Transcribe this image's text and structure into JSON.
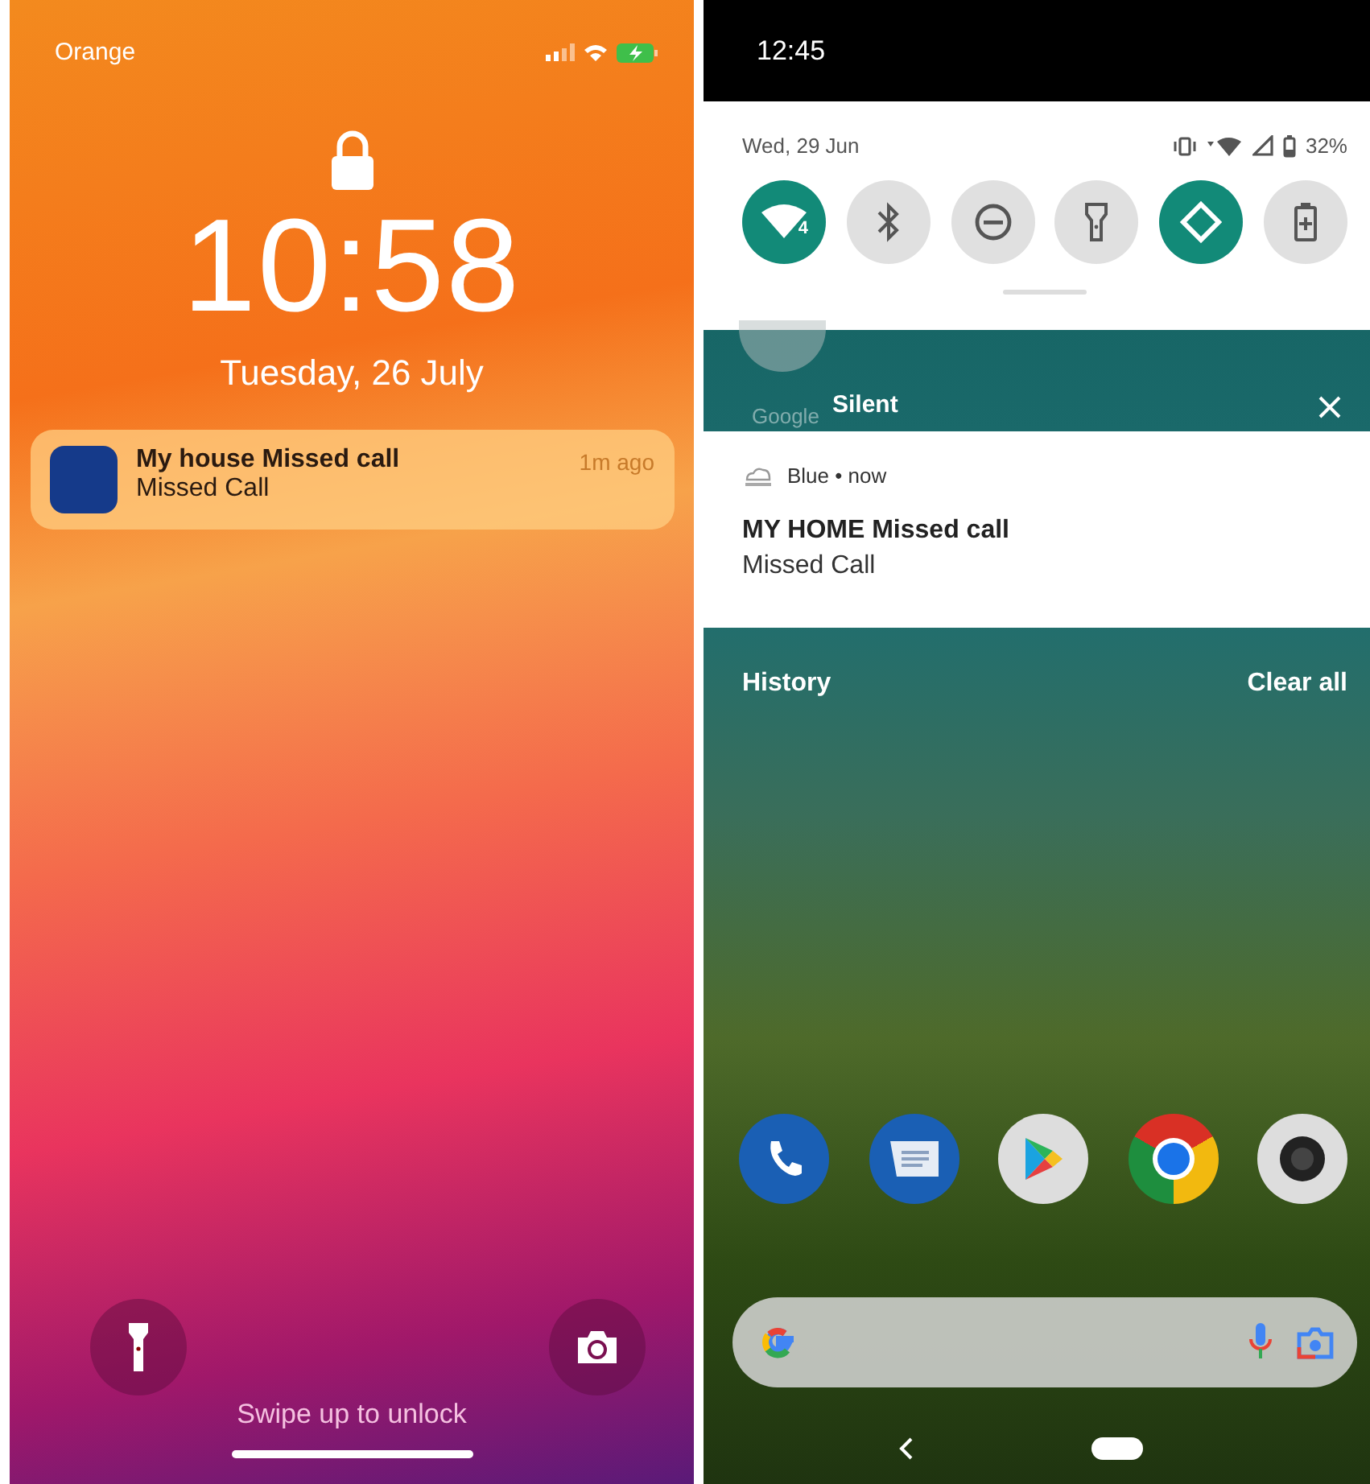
{
  "lock_screen": {
    "carrier": "Orange",
    "time": "10:58",
    "date": "Tuesday, 26 July",
    "notification": {
      "title": "My house Missed call",
      "body": "Missed Call",
      "time": "1m ago"
    },
    "hint": "Swipe up to unlock"
  },
  "android": {
    "status_time": "12:45",
    "date": "Wed, 29 Jun",
    "battery": "32%",
    "tiles": [
      {
        "kind": "wifi",
        "on": true,
        "badge": "4"
      },
      {
        "kind": "bluetooth",
        "on": false
      },
      {
        "kind": "dnd",
        "on": false
      },
      {
        "kind": "flashlight",
        "on": false
      },
      {
        "kind": "rotate",
        "on": true
      },
      {
        "kind": "battery_saver",
        "on": false
      }
    ],
    "folder_label": "Google",
    "section": "Silent",
    "notification": {
      "source": "Blue • now",
      "title": "MY HOME Missed call",
      "body": "Missed Call"
    },
    "history": "History",
    "clear_all": "Clear all",
    "dock": [
      {
        "kind": "phone"
      },
      {
        "kind": "messages"
      },
      {
        "kind": "play"
      },
      {
        "kind": "chrome"
      },
      {
        "kind": "camera"
      }
    ]
  }
}
